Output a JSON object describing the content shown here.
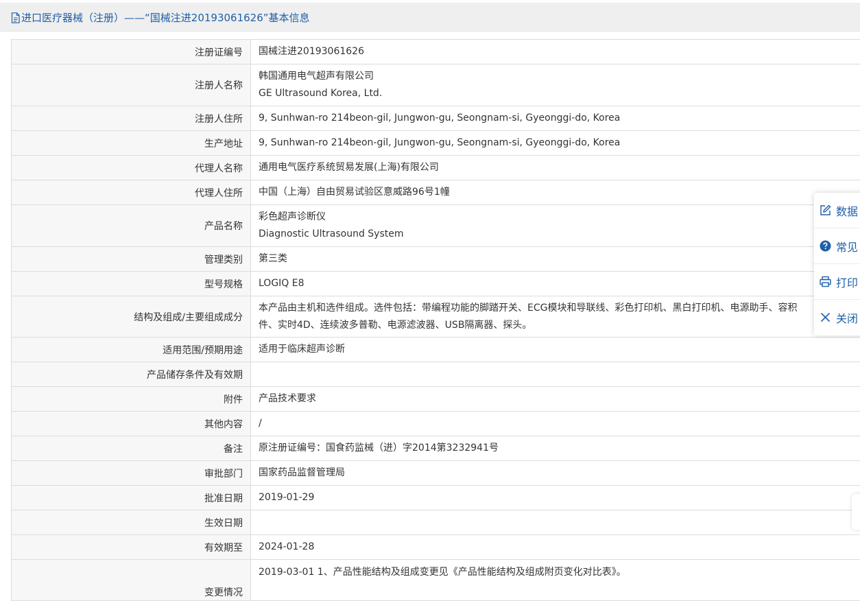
{
  "header": {
    "title": "进口医疗器械（注册）——“国械注进20193061626”基本信息",
    "icon": "document-icon"
  },
  "rows": [
    {
      "label": "注册证编号",
      "lines": [
        "国械注进20193061626"
      ]
    },
    {
      "label": "注册人名称",
      "lines": [
        "韩国通用电气超声有限公司",
        "GE Ultrasound Korea, Ltd."
      ]
    },
    {
      "label": "注册人住所",
      "lines": [
        "9, Sunhwan-ro 214beon-gil, Jungwon-gu, Seongnam-si, Gyeonggi-do, Korea"
      ]
    },
    {
      "label": "生产地址",
      "lines": [
        "9, Sunhwan-ro 214beon-gil, Jungwon-gu, Seongnam-si, Gyeonggi-do, Korea"
      ]
    },
    {
      "label": "代理人名称",
      "lines": [
        "通用电气医疗系统贸易发展(上海)有限公司"
      ]
    },
    {
      "label": "代理人住所",
      "lines": [
        "中国（上海）自由贸易试验区意威路96号1幢"
      ]
    },
    {
      "label": "产品名称",
      "lines": [
        "彩色超声诊断仪",
        "Diagnostic Ultrasound System"
      ]
    },
    {
      "label": "管理类别",
      "lines": [
        "第三类"
      ]
    },
    {
      "label": "型号规格",
      "lines": [
        "LOGIQ E8"
      ]
    },
    {
      "label": "结构及组成/主要组成成分",
      "lines": [
        "本产品由主机和选件组成。选件包括：带编程功能的脚踏开关、ECG模块和导联线、彩色打印机、黑白打印机、电源助手、容积",
        "件、实时4D、连续波多普勒、电源滤波器、USB隔离器、探头。"
      ]
    },
    {
      "label": "适用范围/预期用途",
      "lines": [
        "适用于临床超声诊断"
      ]
    },
    {
      "label": "产品储存条件及有效期",
      "lines": [
        ""
      ]
    },
    {
      "label": "附件",
      "lines": [
        "产品技术要求"
      ]
    },
    {
      "label": "其他内容",
      "lines": [
        "/"
      ]
    },
    {
      "label": "备注",
      "lines": [
        "原注册证编号：国食药监械（进）字2014第3232941号"
      ]
    },
    {
      "label": "审批部门",
      "lines": [
        "国家药品监督管理局"
      ]
    },
    {
      "label": "批准日期",
      "lines": [
        "2019-01-29"
      ]
    },
    {
      "label": "生效日期",
      "lines": [
        ""
      ]
    },
    {
      "label": "有效期至",
      "lines": [
        "2024-01-28"
      ]
    },
    {
      "label": "变更情况",
      "lines": [
        "2019-03-01 1、产品性能结构及组成变更见《产品性能结构及组成附页变化对比表》。"
      ]
    }
  ],
  "float_panel": {
    "items": [
      {
        "label": "数据",
        "icon": "edit-icon"
      },
      {
        "label": "常见",
        "icon": "question-circle-icon"
      },
      {
        "label": "打印",
        "icon": "print-icon"
      },
      {
        "label": "关闭",
        "icon": "close-icon"
      }
    ]
  },
  "colors": {
    "link_blue": "#1f5fa8",
    "header_bg": "#efefef",
    "label_bg": "#f7f7f7",
    "border": "#dcdcdc"
  }
}
